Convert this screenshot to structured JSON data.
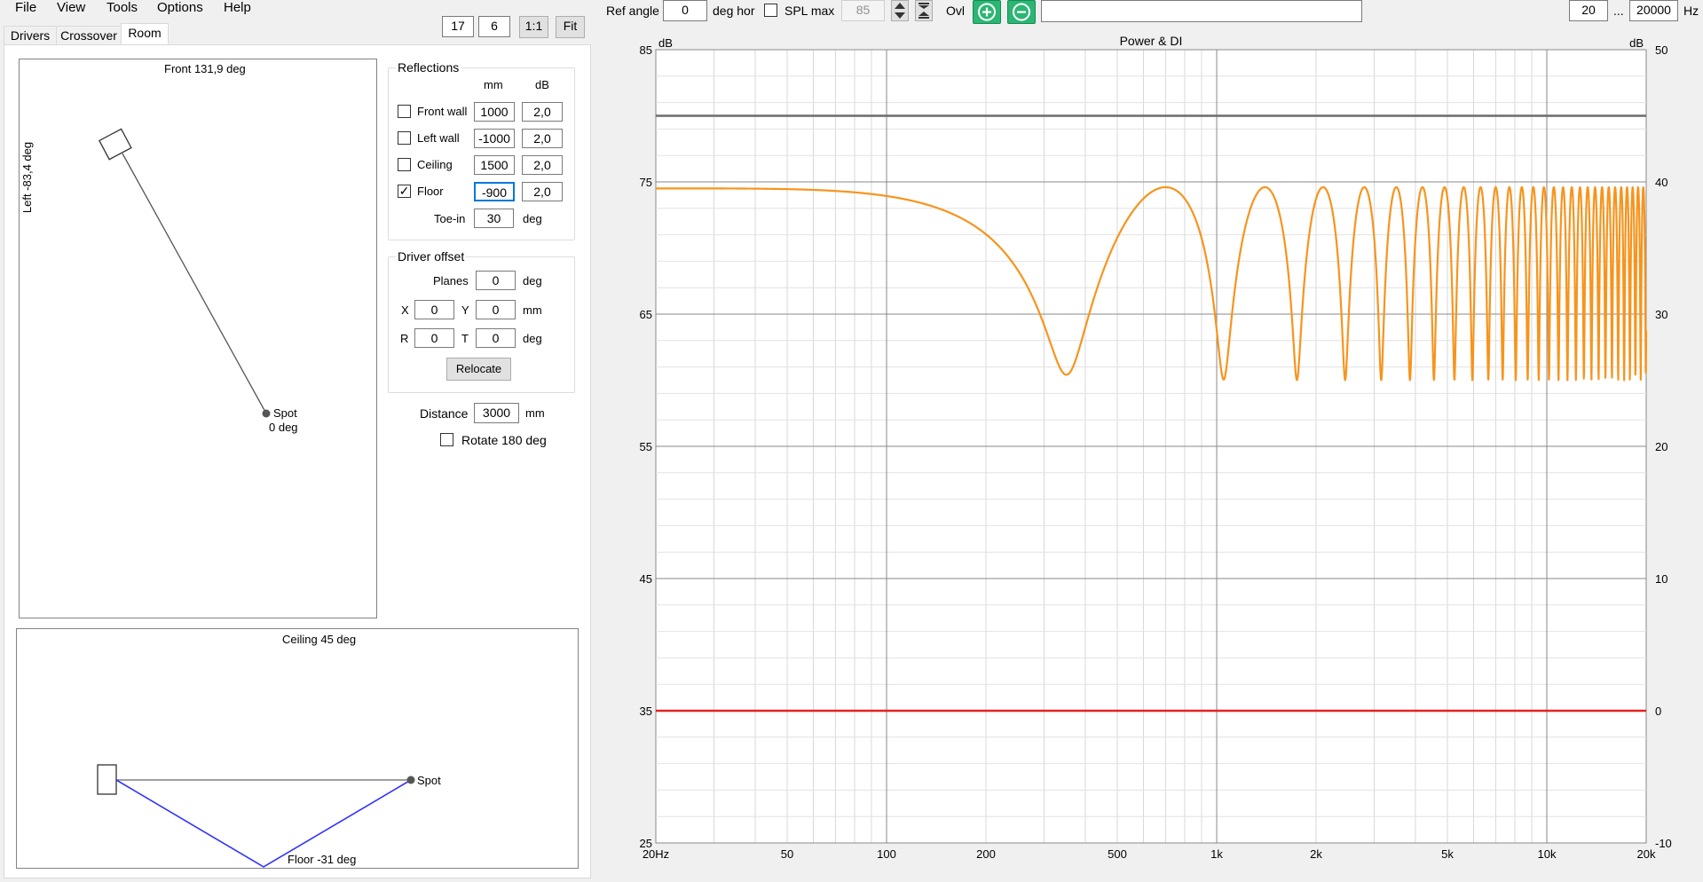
{
  "menu": [
    "File",
    "View",
    "Tools",
    "Options",
    "Help"
  ],
  "tabs": [
    "Drivers",
    "Crossover",
    "Room"
  ],
  "zoom": {
    "a": "17",
    "b": "6",
    "one_to_one": "1:1",
    "fit": "Fit"
  },
  "toolbar": {
    "ref_angle_label": "Ref angle",
    "ref_angle_value": "0",
    "deg_hor": "deg hor",
    "spl_max_label": "SPL max",
    "spl_max_value": "85",
    "ovl_label": "Ovl",
    "freq_min": "20",
    "freq_sep": "...",
    "freq_max": "20000",
    "hz": "Hz"
  },
  "top_view": {
    "front_label": "Front 131,9 deg",
    "left_label": "Left -83,4 deg",
    "spot_label": "Spot",
    "spot_angle": "0 deg"
  },
  "side_view": {
    "ceiling_label": "Ceiling 45 deg",
    "floor_label": "Floor -31 deg",
    "spot_label": "Spot"
  },
  "reflections": {
    "title": "Reflections",
    "col_mm": "mm",
    "col_db": "dB",
    "rows": [
      {
        "label": "Front wall",
        "checked": false,
        "mm": "1000",
        "db": "2,0"
      },
      {
        "label": "Left wall",
        "checked": false,
        "mm": "-1000",
        "db": "2,0"
      },
      {
        "label": "Ceiling",
        "checked": false,
        "mm": "1500",
        "db": "2,0"
      },
      {
        "label": "Floor",
        "checked": true,
        "mm": "-900",
        "db": "2,0"
      }
    ],
    "toe_in_label": "Toe-in",
    "toe_in_value": "30",
    "toe_in_unit": "deg"
  },
  "driver_offset": {
    "title": "Driver offset",
    "planes_label": "Planes",
    "planes_value": "0",
    "planes_unit": "deg",
    "x_label": "X",
    "x_value": "0",
    "y_label": "Y",
    "y_value": "0",
    "xy_unit": "mm",
    "r_label": "R",
    "r_value": "0",
    "t_label": "T",
    "t_value": "0",
    "rt_unit": "deg",
    "relocate": "Relocate"
  },
  "distance": {
    "label": "Distance",
    "value": "3000",
    "unit": "mm"
  },
  "rotate": {
    "label": "Rotate 180 deg",
    "checked": false
  },
  "chart_data": {
    "type": "line",
    "title": "Power & DI",
    "ylabel_left": "dB",
    "ylabel_right": "dB",
    "x_scale": "log",
    "xlim": [
      20,
      20000
    ],
    "x_ticks": [
      {
        "v": 20,
        "label": "20Hz"
      },
      {
        "v": 50,
        "label": "50"
      },
      {
        "v": 100,
        "label": "100"
      },
      {
        "v": 200,
        "label": "200"
      },
      {
        "v": 500,
        "label": "500"
      },
      {
        "v": 1000,
        "label": "1k"
      },
      {
        "v": 2000,
        "label": "2k"
      },
      {
        "v": 5000,
        "label": "5k"
      },
      {
        "v": 10000,
        "label": "10k"
      },
      {
        "v": 20000,
        "label": "20k"
      }
    ],
    "ylim_left": [
      25,
      85
    ],
    "y_ticks_left": [
      "25",
      "35",
      "45",
      "55",
      "65",
      "75",
      "85"
    ],
    "ylim_right": [
      -10,
      50
    ],
    "y_ticks_right": [
      "-10",
      "0",
      "10",
      "20",
      "30",
      "40",
      "50"
    ],
    "grid": true,
    "series": [
      {
        "id": "spl",
        "color": "#f7941d",
        "axis": "left",
        "shape": "reflection-comb",
        "lf_level_db": 74.5,
        "peak_db": 74.6,
        "notch_db": 60.0,
        "first_notch_hz": 350,
        "rolloff_start_hz": 60,
        "trend": [
          [
            20,
            74.5
          ],
          [
            100,
            73.7
          ],
          [
            200,
            71.0
          ],
          [
            350,
            60.0
          ]
        ]
      },
      {
        "id": "power",
        "color": "#6b6b6b",
        "axis": "left",
        "values": [
          [
            20,
            80
          ],
          [
            20000,
            80
          ]
        ]
      },
      {
        "id": "di",
        "color": "#e52222",
        "axis": "right",
        "values": [
          [
            20,
            0
          ],
          [
            20000,
            0
          ]
        ]
      }
    ]
  },
  "colors": {
    "accent_green": "#2bb673",
    "spl": "#f7941d",
    "di": "#e52222",
    "power": "#6b6b6b",
    "floor_path": "#3333ff"
  }
}
